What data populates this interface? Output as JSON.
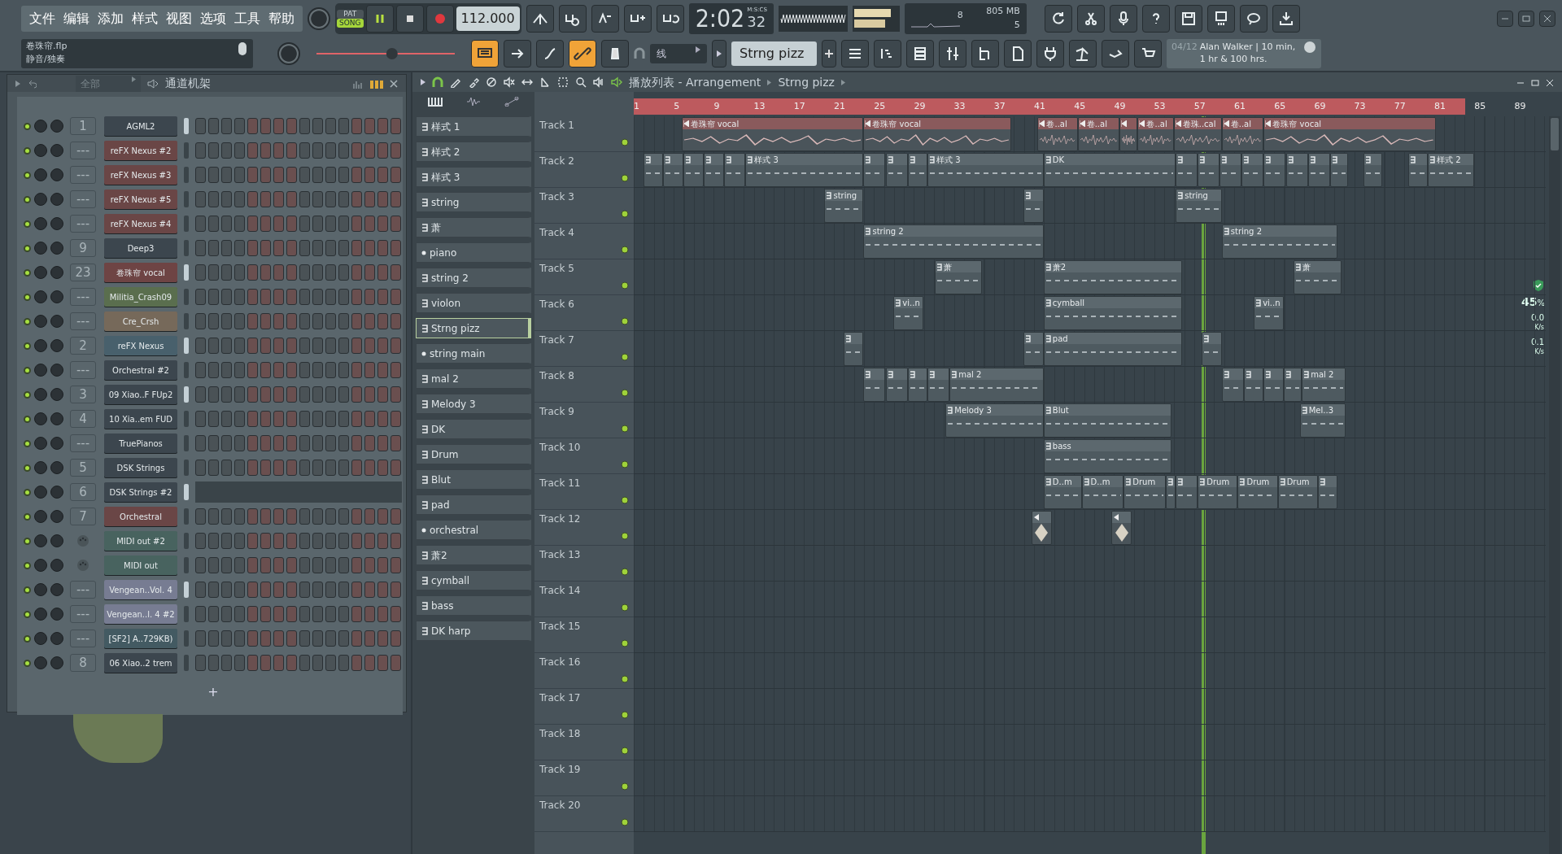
{
  "menu": [
    "文件",
    "编辑",
    "添加",
    "样式",
    "视图",
    "选项",
    "工具",
    "帮助"
  ],
  "project": {
    "file": "卷珠帘.flp",
    "hint": "静音/独奏"
  },
  "transport": {
    "modes": [
      {
        "label": "PAT",
        "selected": false
      },
      {
        "label": "SONG",
        "selected": true
      }
    ],
    "playing": true,
    "tempo": "112.000"
  },
  "master_volume": {
    "level": 0.55
  },
  "time": {
    "main": "2:02",
    "sub": "32",
    "unit": "M:S:CS"
  },
  "monitor": {
    "cpu": "8",
    "memory": "805 MB",
    "polyphony": "5"
  },
  "tool_buttons": [
    {
      "on": true
    },
    {
      "on": false
    },
    {
      "on": false
    },
    {
      "on": true
    },
    {
      "on": false
    }
  ],
  "snap": "线",
  "pattern_selector": "Strng pizz",
  "hint": {
    "date": "04/12",
    "text": "Alan Walker | 10 min, 1 hr & 100 hrs."
  },
  "channel_rack": {
    "filter": "全部",
    "title": "通道机架",
    "add_label": "+",
    "channels": [
      {
        "number": "1",
        "name": "AGML2",
        "color": "#3c464e",
        "selected": true,
        "kind": "steps"
      },
      {
        "number": "---",
        "name": "reFX Nexus #2",
        "color": "#6a4646",
        "selected": false,
        "kind": "steps"
      },
      {
        "number": "---",
        "name": "reFX Nexus #3",
        "color": "#6a4646",
        "selected": false,
        "kind": "steps"
      },
      {
        "number": "---",
        "name": "reFX Nexus #5",
        "color": "#6a4646",
        "selected": false,
        "kind": "steps"
      },
      {
        "number": "---",
        "name": "reFX Nexus #4",
        "color": "#6a4646",
        "selected": false,
        "kind": "steps"
      },
      {
        "number": "9",
        "name": "Deep3",
        "color": "#3c464e",
        "selected": false,
        "kind": "steps"
      },
      {
        "number": "23",
        "name": "卷珠帘 vocal",
        "color": "#6e4444",
        "selected": true,
        "kind": "steps"
      },
      {
        "number": "---",
        "name": "Militia_Crash09",
        "color": "#5a6e4e",
        "selected": false,
        "kind": "steps"
      },
      {
        "number": "---",
        "name": "Cre_Crsh",
        "color": "#76695a",
        "selected": false,
        "kind": "steps"
      },
      {
        "number": "2",
        "name": "reFX Nexus",
        "color": "#48606c",
        "selected": true,
        "kind": "steps"
      },
      {
        "number": "---",
        "name": "Orchestral #2",
        "color": "#3c464e",
        "selected": false,
        "kind": "steps"
      },
      {
        "number": "3",
        "name": "09 Xiao..F FUp2",
        "color": "#3c464e",
        "selected": true,
        "kind": "steps"
      },
      {
        "number": "4",
        "name": "10 Xia..em FUD",
        "color": "#3c464e",
        "selected": false,
        "kind": "steps"
      },
      {
        "number": "---",
        "name": "TruePianos",
        "color": "#3c464e",
        "selected": false,
        "kind": "steps"
      },
      {
        "number": "5",
        "name": "DSK Strings",
        "color": "#3c464e",
        "selected": false,
        "kind": "steps"
      },
      {
        "number": "6",
        "name": "DSK Strings #2",
        "color": "#3c464e",
        "selected": true,
        "kind": "pianoroll"
      },
      {
        "number": "7",
        "name": "Orchestral",
        "color": "#6a4646",
        "selected": false,
        "kind": "steps"
      },
      {
        "name": "MIDI out #2",
        "color": "#48635f",
        "selected": false,
        "kind": "steps"
      },
      {
        "name": "MIDI out",
        "color": "#48635f",
        "selected": false,
        "kind": "steps"
      },
      {
        "number": "---",
        "name": "Vengean..Vol. 4",
        "color": "#777c92",
        "selected": true,
        "kind": "steps"
      },
      {
        "number": "---",
        "name": "Vengean..l. 4 #2",
        "color": "#777c92",
        "selected": false,
        "kind": "steps"
      },
      {
        "number": "---",
        "name": "[SF2] A..729KB)",
        "color": "#435a62",
        "selected": false,
        "kind": "steps"
      },
      {
        "number": "8",
        "name": "06 Xiao..2 trem",
        "color": "#3c464e",
        "selected": false,
        "kind": "steps"
      }
    ]
  },
  "playlist": {
    "title": "播放列表 - Arrangement",
    "current_pattern": "Strng pizz",
    "patterns": [
      {
        "name": "样式 1",
        "kind": "pattern",
        "selected": false
      },
      {
        "name": "样式 2",
        "kind": "pattern",
        "selected": false
      },
      {
        "name": "样式 3",
        "kind": "pattern",
        "selected": false
      },
      {
        "name": "string",
        "kind": "pattern",
        "selected": false
      },
      {
        "name": "萧",
        "kind": "pattern",
        "selected": false
      },
      {
        "name": "piano",
        "kind": "dot",
        "selected": false
      },
      {
        "name": "string 2",
        "kind": "pattern",
        "selected": false
      },
      {
        "name": "violon",
        "kind": "pattern",
        "selected": false
      },
      {
        "name": "Strng pizz",
        "kind": "pattern",
        "selected": true
      },
      {
        "name": "string main",
        "kind": "dot",
        "selected": false
      },
      {
        "name": "mal 2",
        "kind": "pattern",
        "selected": false
      },
      {
        "name": "Melody 3",
        "kind": "pattern",
        "selected": false
      },
      {
        "name": "DK",
        "kind": "pattern",
        "selected": false
      },
      {
        "name": "Drum",
        "kind": "pattern",
        "selected": false
      },
      {
        "name": "Blut",
        "kind": "pattern",
        "selected": false
      },
      {
        "name": "pad",
        "kind": "pattern",
        "selected": false
      },
      {
        "name": "orchestral",
        "kind": "dot",
        "selected": false
      },
      {
        "name": "萧2",
        "kind": "pattern",
        "selected": false
      },
      {
        "name": "cymball",
        "kind": "pattern",
        "selected": false
      },
      {
        "name": "bass",
        "kind": "pattern",
        "selected": false
      },
      {
        "name": "DK harp",
        "kind": "pattern",
        "selected": false
      }
    ],
    "ruler": [
      "1",
      "5",
      "9",
      "13",
      "17",
      "21",
      "25",
      "29",
      "33",
      "37",
      "41",
      "45",
      "49",
      "53",
      "57",
      "61",
      "65",
      "69",
      "73",
      "77",
      "81",
      "85",
      "89"
    ],
    "tracks": [
      {
        "name": "Track 1",
        "clips": [
          {
            "kind": "audio",
            "name": "卷珠帘 vocal"
          },
          {
            "kind": "audio",
            "name": "卷珠帘 vocal"
          },
          {
            "kind": "audio",
            "name": "卷..al"
          },
          {
            "kind": "audio",
            "name": "卷..al"
          },
          {
            "kind": "audio"
          },
          {
            "kind": "audio",
            "name": "卷..al"
          },
          {
            "kind": "audio",
            "name": "卷珠..cal"
          },
          {
            "kind": "audio",
            "name": "卷..al"
          },
          {
            "kind": "audio",
            "name": "卷珠帘 vocal"
          }
        ]
      },
      {
        "name": "Track 2",
        "clips": [
          {
            "kind": "pattern"
          },
          {
            "kind": "pattern"
          },
          {
            "kind": "pattern"
          },
          {
            "kind": "pattern"
          },
          {
            "kind": "pattern"
          },
          {
            "kind": "pattern",
            "name": "样式 3"
          },
          {
            "kind": "pattern"
          },
          {
            "kind": "pattern"
          },
          {
            "kind": "pattern"
          },
          {
            "kind": "pattern",
            "name": "样式 3"
          },
          {
            "kind": "pattern",
            "name": "DK"
          },
          {
            "kind": "pattern"
          },
          {
            "kind": "pattern"
          },
          {
            "kind": "pattern"
          },
          {
            "kind": "pattern"
          },
          {
            "kind": "pattern"
          },
          {
            "kind": "pattern"
          },
          {
            "kind": "pattern"
          },
          {
            "kind": "pattern"
          },
          {
            "kind": "pattern"
          },
          {
            "kind": "pattern"
          },
          {
            "kind": "pattern",
            "name": "样式 2"
          }
        ]
      },
      {
        "name": "Track 3",
        "clips": [
          {
            "kind": "pattern",
            "name": "string"
          },
          {
            "kind": "pattern"
          },
          {
            "kind": "pattern",
            "name": "string"
          }
        ]
      },
      {
        "name": "Track 4",
        "clips": [
          {
            "kind": "pattern",
            "name": "string 2"
          },
          {
            "kind": "pattern",
            "name": "string 2"
          }
        ]
      },
      {
        "name": "Track 5",
        "clips": [
          {
            "kind": "pattern",
            "name": "萧"
          },
          {
            "kind": "pattern",
            "name": "萧2"
          },
          {
            "kind": "pattern",
            "name": "萧"
          }
        ]
      },
      {
        "name": "Track 6",
        "clips": [
          {
            "kind": "pattern",
            "name": "vi..n"
          },
          {
            "kind": "pattern",
            "name": "cymball"
          },
          {
            "kind": "pattern",
            "name": "vi..n"
          }
        ]
      },
      {
        "name": "Track 7",
        "clips": [
          {
            "kind": "pattern"
          },
          {
            "kind": "pattern"
          },
          {
            "kind": "pattern",
            "name": "pad"
          },
          {
            "kind": "pattern"
          }
        ]
      },
      {
        "name": "Track 8",
        "clips": [
          {
            "kind": "pattern"
          },
          {
            "kind": "pattern"
          },
          {
            "kind": "pattern"
          },
          {
            "kind": "pattern"
          },
          {
            "kind": "pattern",
            "name": "mal 2"
          },
          {
            "kind": "pattern"
          },
          {
            "kind": "pattern"
          },
          {
            "kind": "pattern"
          },
          {
            "kind": "pattern"
          },
          {
            "kind": "pattern",
            "name": "mal 2"
          }
        ]
      },
      {
        "name": "Track 9",
        "clips": [
          {
            "kind": "pattern",
            "name": "Melody 3"
          },
          {
            "kind": "pattern",
            "name": "Blut"
          },
          {
            "kind": "pattern",
            "name": "Mel..3"
          }
        ]
      },
      {
        "name": "Track 10",
        "clips": [
          {
            "kind": "pattern",
            "name": "bass"
          }
        ]
      },
      {
        "name": "Track 11",
        "clips": [
          {
            "kind": "pattern",
            "name": "D..m"
          },
          {
            "kind": "pattern",
            "name": "D..m"
          },
          {
            "kind": "pattern",
            "name": "Drum"
          },
          {
            "kind": "pattern"
          },
          {
            "kind": "pattern"
          },
          {
            "kind": "pattern",
            "name": "Drum"
          },
          {
            "kind": "pattern",
            "name": "Drum"
          },
          {
            "kind": "pattern",
            "name": "Drum"
          },
          {
            "kind": "pattern"
          }
        ]
      },
      {
        "name": "Track 12",
        "clips": [
          {
            "kind": "automation"
          },
          {
            "kind": "automation"
          }
        ]
      },
      {
        "name": "Track 13"
      },
      {
        "name": "Track 14"
      },
      {
        "name": "Track 15"
      },
      {
        "name": "Track 16"
      },
      {
        "name": "Track 17"
      },
      {
        "name": "Track 18"
      },
      {
        "name": "Track 19"
      },
      {
        "name": "Track 20"
      }
    ]
  },
  "stats": {
    "cpu": "45",
    "cpu_unit": "%",
    "up": "0.0",
    "up_unit": "K/s",
    "down": "0.1",
    "down_unit": "K/s"
  }
}
